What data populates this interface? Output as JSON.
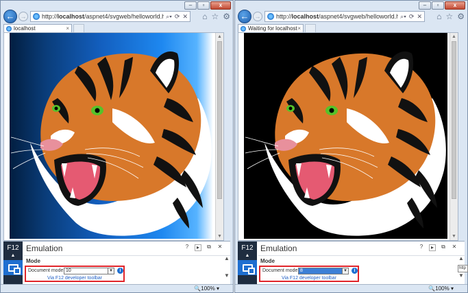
{
  "windows": [
    {
      "url_prefix": "http://",
      "url_host": "localhost",
      "url_path": "/aspnet4/svgweb/helloworld.html",
      "tab_title": "localhost",
      "devtools": {
        "f12_label": "F12",
        "panel_title": "Emulation",
        "section": "Mode",
        "doc_mode_label": "Document mode",
        "doc_mode_value": "10",
        "link_text": "Via F12 developer toolbar"
      },
      "zoom": "100%"
    },
    {
      "url_prefix": "http://",
      "url_host": "localhost",
      "url_path": "/aspnet4/svgweb/helloworld.html",
      "tab_title": "Waiting for localhost",
      "devtools": {
        "f12_label": "F12",
        "panel_title": "Emulation",
        "section": "Mode",
        "doc_mode_label": "Document mode",
        "doc_mode_value": "8",
        "link_text": "Via F12 developer toolbar"
      },
      "zoom": "100%"
    }
  ],
  "tooltip_text": "http",
  "icons": [
    "back-arrow-icon",
    "forward-arrow-icon",
    "refresh-icon",
    "home-icon",
    "favorites-star-icon",
    "settings-gear-icon",
    "emulation-icon",
    "info-icon"
  ]
}
